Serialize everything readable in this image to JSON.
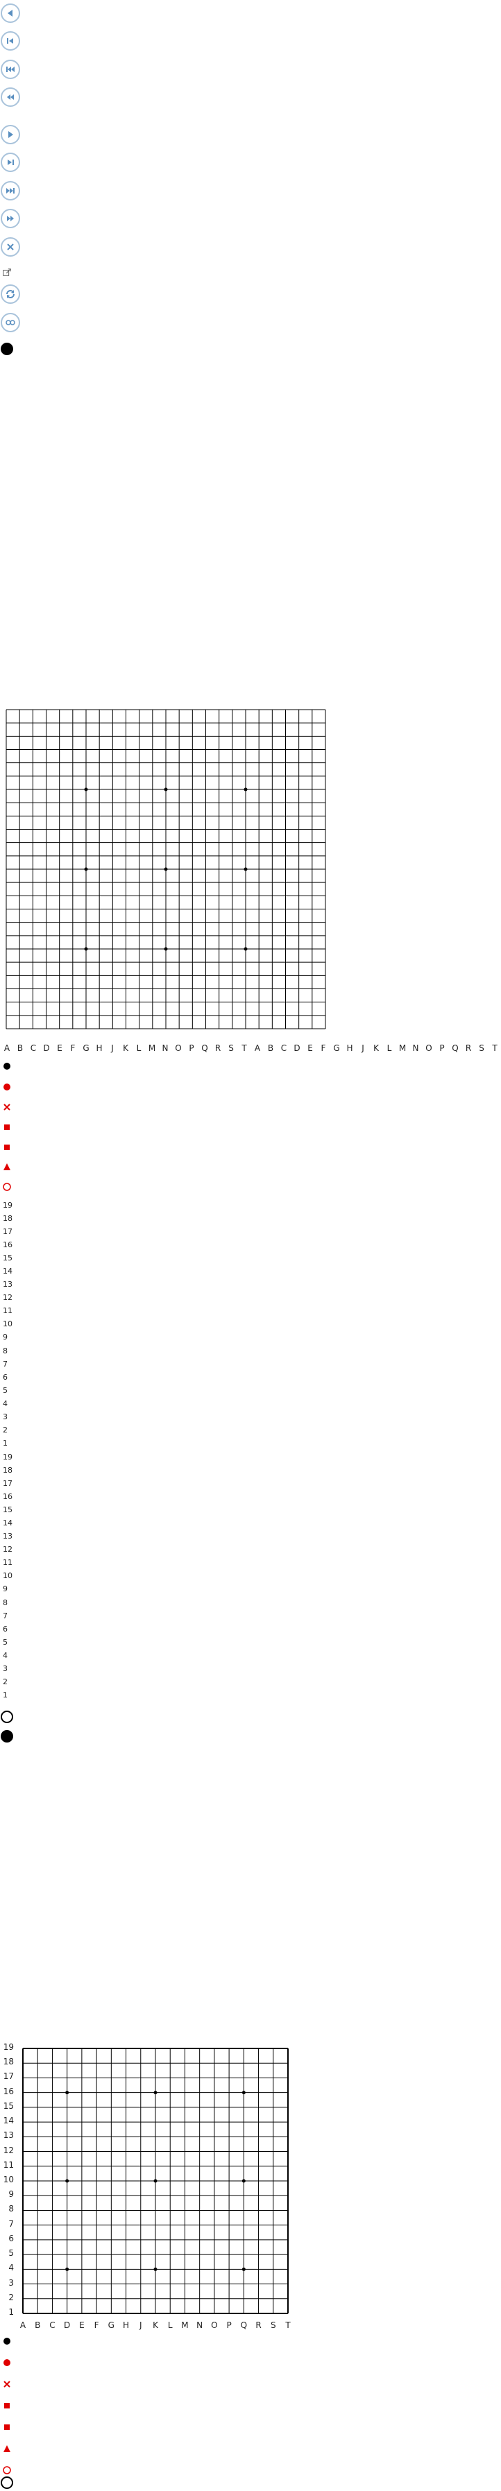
{
  "nav_buttons": [
    {
      "name": "back-button",
      "icon": "triangle-left"
    },
    {
      "name": "first-move-button",
      "icon": "skip-start"
    },
    {
      "name": "previous-branch-button",
      "icon": "skip-back-fast"
    },
    {
      "name": "rewind-button",
      "icon": "double-left"
    },
    {
      "name": "play-button",
      "icon": "triangle-right"
    },
    {
      "name": "last-move-button",
      "icon": "skip-end"
    },
    {
      "name": "next-branch-button",
      "icon": "skip-forward-fast"
    },
    {
      "name": "fast-forward-button",
      "icon": "double-right"
    },
    {
      "name": "close-button",
      "icon": "cross"
    },
    {
      "name": "external-link-icon",
      "icon": "external-link"
    },
    {
      "name": "rotate-button",
      "icon": "rotate"
    },
    {
      "name": "coordinates-button",
      "icon": "glasses"
    }
  ],
  "board1": {
    "columns_top": [
      "A",
      "B",
      "C",
      "D",
      "E",
      "F",
      "G",
      "H",
      "J",
      "K",
      "L",
      "M",
      "N",
      "O",
      "P",
      "Q",
      "R",
      "S",
      "T",
      "A",
      "B",
      "C",
      "D",
      "E",
      "F",
      "G",
      "H",
      "J",
      "K",
      "L",
      "M",
      "N",
      "O",
      "P",
      "Q",
      "R",
      "S",
      "T"
    ],
    "rows_a": [
      "19",
      "18",
      "17",
      "16",
      "15",
      "14",
      "13",
      "12",
      "11",
      "10",
      "9",
      "8",
      "7",
      "6",
      "5",
      "4",
      "3",
      "2",
      "1"
    ],
    "rows_b": [
      "19",
      "18",
      "17",
      "16",
      "15",
      "14",
      "13",
      "12",
      "11",
      "10",
      "9",
      "8",
      "7",
      "6",
      "5",
      "4",
      "3",
      "2",
      "1"
    ]
  },
  "board2": {
    "rows": [
      "19",
      "18",
      "17",
      "16",
      "15",
      "14",
      "13",
      "12",
      "11",
      "10",
      "9",
      "8",
      "7",
      "6",
      "5",
      "4",
      "3",
      "2",
      "1"
    ],
    "columns": [
      "A",
      "B",
      "C",
      "D",
      "E",
      "F",
      "G",
      "H",
      "J",
      "K",
      "L",
      "M",
      "N",
      "O",
      "P",
      "Q",
      "R",
      "S",
      "T"
    ]
  },
  "marker_legend": [
    "black-stone",
    "red-dot",
    "red-cross",
    "red-square",
    "red-square",
    "red-triangle",
    "red-circle"
  ],
  "colors": {
    "accent": "#5a8fc0",
    "button_border": "#a9c3db",
    "marker_red": "#e00000",
    "board_line": "#000000"
  }
}
